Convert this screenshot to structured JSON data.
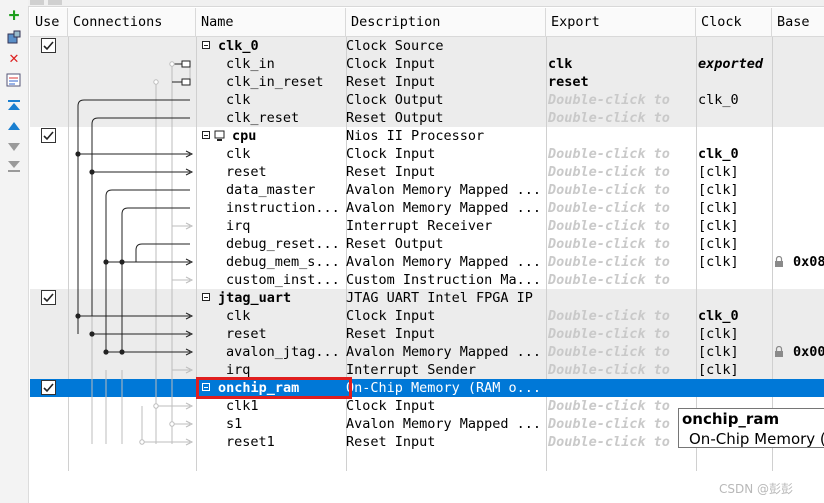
{
  "toolbar": {
    "icons": [
      "add-icon",
      "component-icon",
      "remove-icon",
      "edit-icon",
      "move-top-icon",
      "move-up-icon",
      "move-down-icon",
      "move-bottom-icon"
    ]
  },
  "columns": [
    "Use",
    "Connections",
    "Name",
    "Description",
    "Export",
    "Clock",
    "Base"
  ],
  "rows": [
    {
      "kind": "group",
      "use": true,
      "name": "clk_0",
      "desc": "Clock Source",
      "export": "",
      "clock": "",
      "base": ""
    },
    {
      "kind": "iface",
      "name": "clk_in",
      "desc": "Clock Input",
      "export": "clk",
      "export_style": "bold",
      "clock": "exported",
      "clock_style": "boldital",
      "base": ""
    },
    {
      "kind": "iface",
      "name": "clk_in_reset",
      "desc": "Reset Input",
      "export": "reset",
      "export_style": "bold",
      "clock": "",
      "base": ""
    },
    {
      "kind": "iface",
      "name": "clk",
      "desc": "Clock Output",
      "export": "Double-click to",
      "export_style": "dbl",
      "clock": "clk_0",
      "base": ""
    },
    {
      "kind": "iface",
      "name": "clk_reset",
      "desc": "Reset Output",
      "export": "Double-click to",
      "export_style": "dbl",
      "clock": "",
      "base": ""
    },
    {
      "kind": "group",
      "use": true,
      "name": "cpu",
      "desc": "Nios II Processor",
      "export": "",
      "clock": "",
      "base": "",
      "proc_icon": true
    },
    {
      "kind": "iface",
      "name": "clk",
      "desc": "Clock Input",
      "export": "Double-click to",
      "export_style": "dbl",
      "clock": "clk_0",
      "clock_style": "bold",
      "base": ""
    },
    {
      "kind": "iface",
      "name": "reset",
      "desc": "Reset Input",
      "export": "Double-click to",
      "export_style": "dbl",
      "clock": "[clk]",
      "base": ""
    },
    {
      "kind": "iface",
      "name": "data_master",
      "desc": "Avalon Memory Mapped ...",
      "export": "Double-click to",
      "export_style": "dbl",
      "clock": "[clk]",
      "base": ""
    },
    {
      "kind": "iface",
      "name": "instruction...",
      "desc": "Avalon Memory Mapped ...",
      "export": "Double-click to",
      "export_style": "dbl",
      "clock": "[clk]",
      "base": ""
    },
    {
      "kind": "iface",
      "name": "irq",
      "desc": "Interrupt Receiver",
      "export": "Double-click to",
      "export_style": "dbl",
      "clock": "[clk]",
      "base": ""
    },
    {
      "kind": "iface",
      "name": "debug_reset...",
      "desc": "Reset Output",
      "export": "Double-click to",
      "export_style": "dbl",
      "clock": "[clk]",
      "base": ""
    },
    {
      "kind": "iface",
      "name": "debug_mem_s...",
      "desc": "Avalon Memory Mapped ...",
      "export": "Double-click to",
      "export_style": "dbl",
      "clock": "[clk]",
      "base": "0x08",
      "lock": true
    },
    {
      "kind": "iface",
      "name": "custom_inst...",
      "desc": "Custom Instruction Ma...",
      "export": "Double-click to",
      "export_style": "dbl",
      "clock": "",
      "base": ""
    },
    {
      "kind": "group",
      "use": true,
      "name": "jtag_uart",
      "desc": "JTAG UART Intel FPGA IP",
      "export": "",
      "clock": "",
      "base": ""
    },
    {
      "kind": "iface",
      "name": "clk",
      "desc": "Clock Input",
      "export": "Double-click to",
      "export_style": "dbl",
      "clock": "clk_0",
      "clock_style": "bold",
      "base": ""
    },
    {
      "kind": "iface",
      "name": "reset",
      "desc": "Reset Input",
      "export": "Double-click to",
      "export_style": "dbl",
      "clock": "[clk]",
      "base": ""
    },
    {
      "kind": "iface",
      "name": "avalon_jtag...",
      "desc": "Avalon Memory Mapped ...",
      "export": "Double-click to",
      "export_style": "dbl",
      "clock": "[clk]",
      "base": "0x00",
      "lock": true
    },
    {
      "kind": "iface",
      "name": "irq",
      "desc": "Interrupt Sender",
      "export": "Double-click to",
      "export_style": "dbl",
      "clock": "[clk]",
      "base": ""
    },
    {
      "kind": "group",
      "use": true,
      "name": "onchip_ram",
      "desc": "On-Chip Memory (RAM o...",
      "export": "",
      "clock": "",
      "base": "",
      "selected": true
    },
    {
      "kind": "iface",
      "name": "clk1",
      "desc": "Clock Input",
      "export": "Double-click to",
      "export_style": "dbl",
      "clock": "",
      "base": ""
    },
    {
      "kind": "iface",
      "name": "s1",
      "desc": "Avalon Memory Mapped ...",
      "export": "Double-click to",
      "export_style": "dbl",
      "clock": "",
      "base": ""
    },
    {
      "kind": "iface",
      "name": "reset1",
      "desc": "Reset Input",
      "export": "Double-click to",
      "export_style": "dbl",
      "clock": "",
      "base": ""
    }
  ],
  "tooltip": {
    "title": "onchip_ram",
    "desc": "On-Chip Memory ("
  },
  "watermark": "CSDN @彭彭"
}
